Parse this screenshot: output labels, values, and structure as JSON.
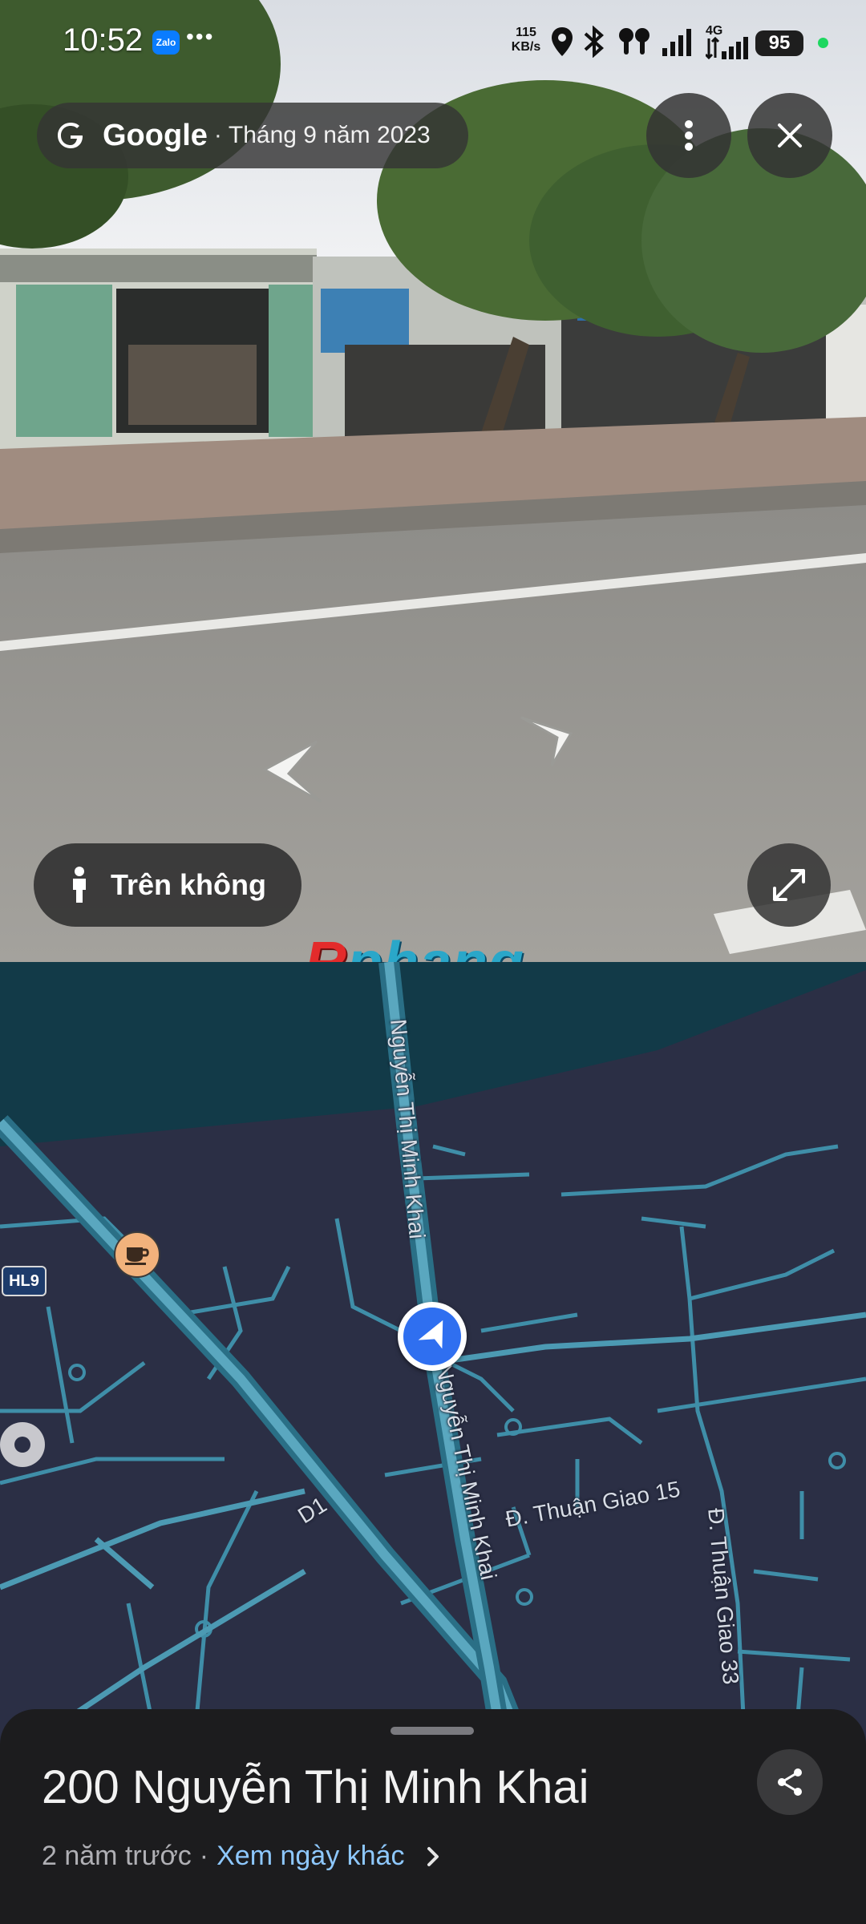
{
  "status_bar": {
    "time": "10:52",
    "notification_app": "Zalo",
    "more_indicator": "•••",
    "speed_value": "115",
    "speed_unit": "KB/s",
    "network": "4G",
    "battery": "95"
  },
  "street_view": {
    "brand": "Google",
    "separator": "·",
    "capture_date": "Tháng 9 năm 2023",
    "aerial_label": "Trên không",
    "watermark_r": "R",
    "watermark_rest": "phang"
  },
  "map": {
    "labels": {
      "main_road_north": "Nguyễn Thị Minh Khai",
      "main_road_south": "Nguyễn Thị Minh Khai",
      "d1": "D1",
      "thuan_giao_15": "Đ. Thuận Giao 15",
      "thuan_giao_33": "Đ. Thuận Giao 33",
      "shield": "HL9"
    },
    "colors": {
      "water": "#123a48",
      "land": "#2b2f45",
      "road": "#5aa7bf"
    }
  },
  "place": {
    "address": "200 Nguyễn Thị Minh Khai",
    "age": "2 năm trước",
    "separator": "·",
    "other_dates_link": "Xem ngày khác"
  }
}
